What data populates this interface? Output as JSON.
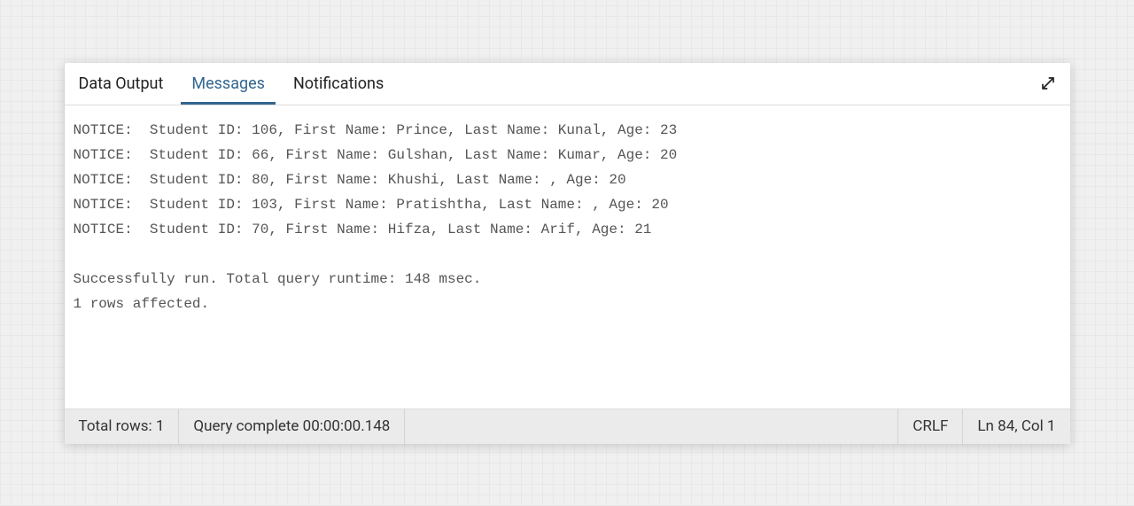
{
  "tabs": {
    "data_output": "Data Output",
    "messages": "Messages",
    "notifications": "Notifications"
  },
  "messages": {
    "notices": [
      "NOTICE:  Student ID: 106, First Name: Prince, Last Name: Kunal, Age: 23",
      "NOTICE:  Student ID: 66, First Name: Gulshan, Last Name: Kumar, Age: 20",
      "NOTICE:  Student ID: 80, First Name: Khushi, Last Name: , Age: 20",
      "NOTICE:  Student ID: 103, First Name: Pratishtha, Last Name: , Age: 20",
      "NOTICE:  Student ID: 70, First Name: Hifza, Last Name: Arif, Age: 21"
    ],
    "summary_line1": "Successfully run. Total query runtime: 148 msec.",
    "summary_line2": "1 rows affected."
  },
  "statusbar": {
    "total_rows": "Total rows: 1",
    "query_complete": "Query complete 00:00:00.148",
    "line_ending": "CRLF",
    "cursor_position": "Ln 84, Col 1"
  }
}
